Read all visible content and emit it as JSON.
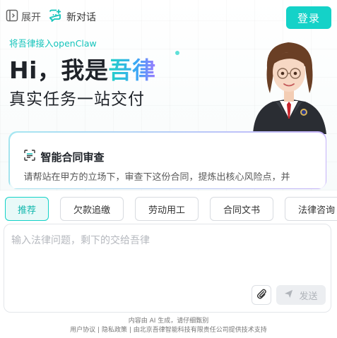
{
  "topbar": {
    "expand_label": "展开",
    "new_chat_label": "新对话",
    "login_label": "登录"
  },
  "hero": {
    "openclaw_link": "将吾律接入openClaw",
    "headline_prefix": "Hi，我是",
    "headline_brand": "吾律",
    "subline": "真实任务一站交付"
  },
  "feature_card": {
    "title": "智能合同审查",
    "description": "请帮站在甲方的立场下，审查下这份合同，提炼出核心风险点，并"
  },
  "chips": [
    {
      "label": "推荐",
      "active": true
    },
    {
      "label": "欠款追缴",
      "active": false
    },
    {
      "label": "劳动用工",
      "active": false
    },
    {
      "label": "合同文书",
      "active": false
    },
    {
      "label": "法律咨询",
      "active": false
    }
  ],
  "composer": {
    "placeholder": "输入法律问题，剩下的交给吾律",
    "send_label": "发送"
  },
  "footer": {
    "ai_notice": "内容由 AI 生成，请仔细甄别",
    "user_agreement": "用户协议",
    "separator": "|",
    "privacy_policy": "隐私政策",
    "provider": "由北京吾律智能科技有限责任公司提供技术支持"
  },
  "colors": {
    "accent": "#14d2c8",
    "chip_active_bg": "#e8f9f8"
  },
  "icons": {
    "expand": "sidebar-expand-icon",
    "new_chat": "new-chat-icon",
    "card": "scan-document-icon",
    "attach": "paperclip-icon",
    "send": "send-arrow-icon"
  }
}
